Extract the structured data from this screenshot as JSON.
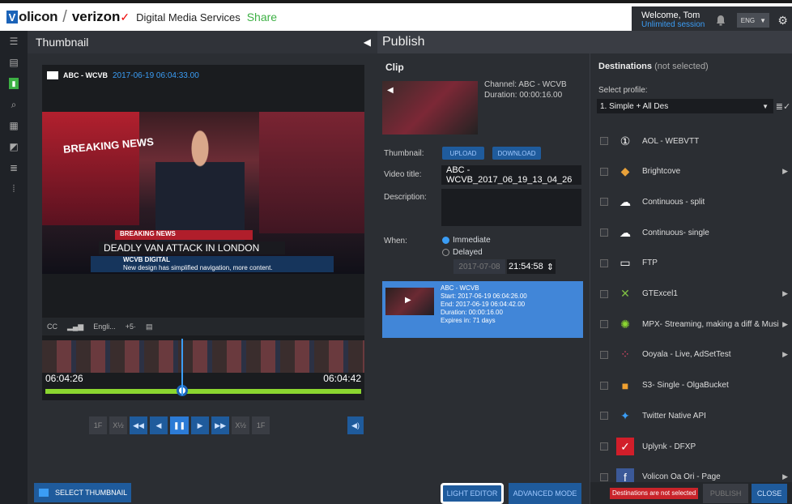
{
  "brand": {
    "name": "olicon",
    "separator": "/",
    "partner": "verizon",
    "product": "Digital Media Services",
    "module": "Share"
  },
  "user": {
    "welcome": "Welcome, Tom",
    "session": "Unlimited session",
    "language": "ENG"
  },
  "thumbnail_panel": {
    "title": "Thumbnail",
    "channel": "ABC - WCVB",
    "timestamp": "2017-06-19 06:04:33.00",
    "time_start": "06:04:26",
    "time_end": "06:04:42",
    "cc": "CC",
    "lang_placeholder": "Engli...",
    "speed": "+5·",
    "select_button": "SELECT THUMBNAIL"
  },
  "video_overlay": {
    "breaking": "BREAKING NEWS",
    "lower1": "BREAKING NEWS",
    "lower2": "DEADLY VAN ATTACK IN LONDON",
    "lower3_title": "WCVB DIGITAL",
    "lower3_sub": "New design has simplified navigation, more content."
  },
  "transport": {
    "back1": "1F",
    "slow_back": "X½",
    "rewind": "◀◀",
    "step_back": "◀",
    "pause": "❚❚",
    "play": "▶",
    "ffwd": "▶▶",
    "slow_fwd": "X½",
    "fwd1": "1F",
    "volume": "◀)"
  },
  "publish": {
    "title": "Publish",
    "clip_label": "Clip",
    "channel": "Channel: ABC - WCVB",
    "duration": "Duration: 00:00:16.00",
    "thumbnail_label": "Thumbnail:",
    "upload": "UPLOAD",
    "download": "DOWNLOAD",
    "video_title_label": "Video title:",
    "video_title": "ABC - WCVB_2017_06_19_13_04_26",
    "description_label": "Description:",
    "when_label": "When:",
    "immediate": "Immediate",
    "delayed": "Delayed",
    "date": "2017-07-08",
    "time": "21:54:58",
    "light_editor": "LIGHT EDITOR",
    "advanced_mode": "ADVANCED MODE"
  },
  "selected_clip": {
    "name": "ABC - WCVB",
    "start": "Start: 2017-06-19 06:04:26.00",
    "end": "End: 2017-06-19 06:04:42.00",
    "duration": "Duration: 00:00:16.00",
    "expires": "Expires in: 71 days"
  },
  "destinations": {
    "title": "Destinations",
    "status": "(not selected)",
    "select_profile": "Select profile:",
    "profile": "1. Simple + All Des",
    "items": [
      {
        "name": "AOL - WEBVTT",
        "icon": "aol-icon",
        "chevron": false
      },
      {
        "name": "Brightcove",
        "icon": "brightcove-icon",
        "chevron": true
      },
      {
        "name": "Continuous - split",
        "icon": "cloud-icon",
        "chevron": false
      },
      {
        "name": "Continuous- single",
        "icon": "cloud-icon",
        "chevron": false
      },
      {
        "name": "FTP",
        "icon": "laptop-icon",
        "chevron": false
      },
      {
        "name": "GTExcel1",
        "icon": "gtexcel-icon",
        "chevron": true
      },
      {
        "name": "MPX- Streaming, making a diff & Musi",
        "icon": "mpx-icon",
        "chevron": true
      },
      {
        "name": "Ooyala - Live, AdSetTest",
        "icon": "ooyala-icon",
        "chevron": true
      },
      {
        "name": "S3- Single - OlgaBucket",
        "icon": "s3-icon",
        "chevron": false
      },
      {
        "name": "Twitter Native API",
        "icon": "twitter-icon",
        "chevron": false
      },
      {
        "name": "Uplynk - DFXP",
        "icon": "uplynk-icon",
        "chevron": false
      },
      {
        "name": "Volicon Oa Ori - Page",
        "icon": "facebook-icon",
        "chevron": true
      }
    ],
    "error": "Destinations are not selected",
    "publish": "PUBLISH",
    "close": "CLOSE"
  },
  "colors": {
    "accent": "#1f5b9c",
    "highlight": "#4186d8",
    "green": "#8bd630",
    "error": "#c9242a"
  }
}
